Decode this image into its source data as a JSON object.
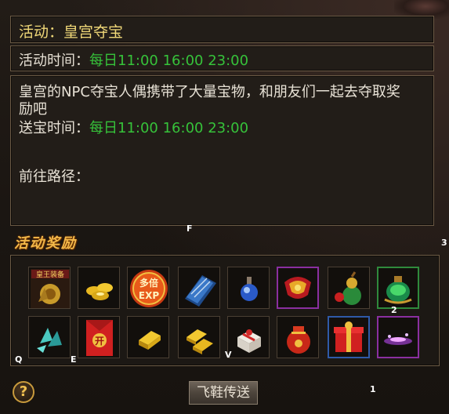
{
  "title": "活动：皇宫夺宝",
  "activity_time": {
    "label": "活动时间：",
    "value": "每日11:00 16:00 23:00"
  },
  "description": {
    "line1": "皇宫的NPC夺宝人偶携带了大量宝物，和朋友们一起去夺取奖",
    "line2": "励吧",
    "delivery_label": "送宝时间：",
    "delivery_value": "每日11:00 16:00 23:00",
    "route_label": "前往路径："
  },
  "rewards_title": "活动奖励",
  "reward_items_row1": [
    {
      "icon": "imperial-equipment-icon",
      "text": "皇王装备"
    },
    {
      "icon": "gold-ingots-icon"
    },
    {
      "icon": "multi-exp-icon",
      "text1": "多倍",
      "text2": "EXP"
    },
    {
      "icon": "skill-book-icon"
    },
    {
      "icon": "potion-bottle-icon"
    },
    {
      "icon": "red-ornament-icon"
    },
    {
      "icon": "gourd-icon"
    },
    {
      "icon": "green-jar-icon"
    }
  ],
  "reward_items_row2": [
    {
      "icon": "crystal-shards-icon"
    },
    {
      "icon": "red-envelope-icon",
      "text": "开"
    },
    {
      "icon": "gold-bar-icon"
    },
    {
      "icon": "gold-bars-icon"
    },
    {
      "icon": "gift-box-white-icon"
    },
    {
      "icon": "lucky-bag-icon"
    },
    {
      "icon": "red-gift-box-icon"
    },
    {
      "icon": "purple-mist-icon"
    }
  ],
  "markers": {
    "f": "F",
    "three": "3",
    "two": "2",
    "q": "Q",
    "e": "E",
    "v": "V",
    "one": "1"
  },
  "help_label": "?",
  "fly_button_label": "飞鞋传送",
  "colors": {
    "title": "#f0d878",
    "time": "#36c23a",
    "rewards_title": "#f2b84a"
  }
}
